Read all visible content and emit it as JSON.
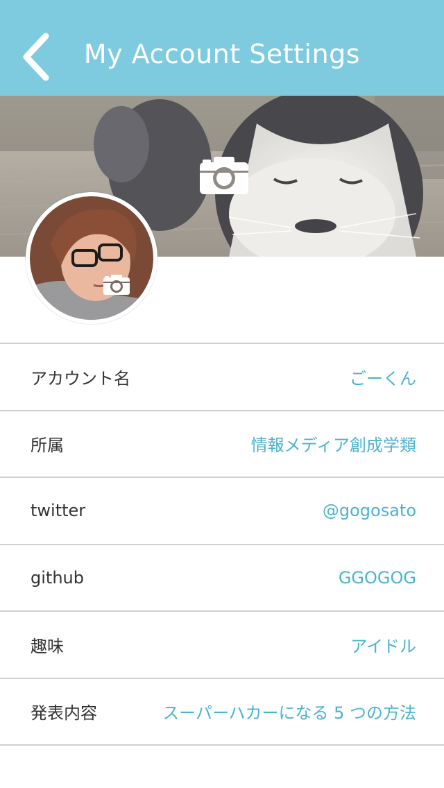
{
  "header": {
    "title": "My Account Settings",
    "back_icon": "chevron-left-icon",
    "background_color": "#7ecadf"
  },
  "cover": {
    "camera_icon": "camera-icon"
  },
  "avatar": {
    "camera_icon": "camera-icon"
  },
  "settings": {
    "accent_color": "#4bb3cd",
    "rows": [
      {
        "label": "アカウント名",
        "value": "ごーくん"
      },
      {
        "label": "所属",
        "value": "情報メディア創成学類"
      },
      {
        "label": "twitter",
        "value": "@gogosato"
      },
      {
        "label": "github",
        "value": "GGOGOG"
      },
      {
        "label": "趣味",
        "value": "アイドル"
      },
      {
        "label": "発表内容",
        "value": "スーパーハカーになる 5 つの方法"
      }
    ]
  }
}
